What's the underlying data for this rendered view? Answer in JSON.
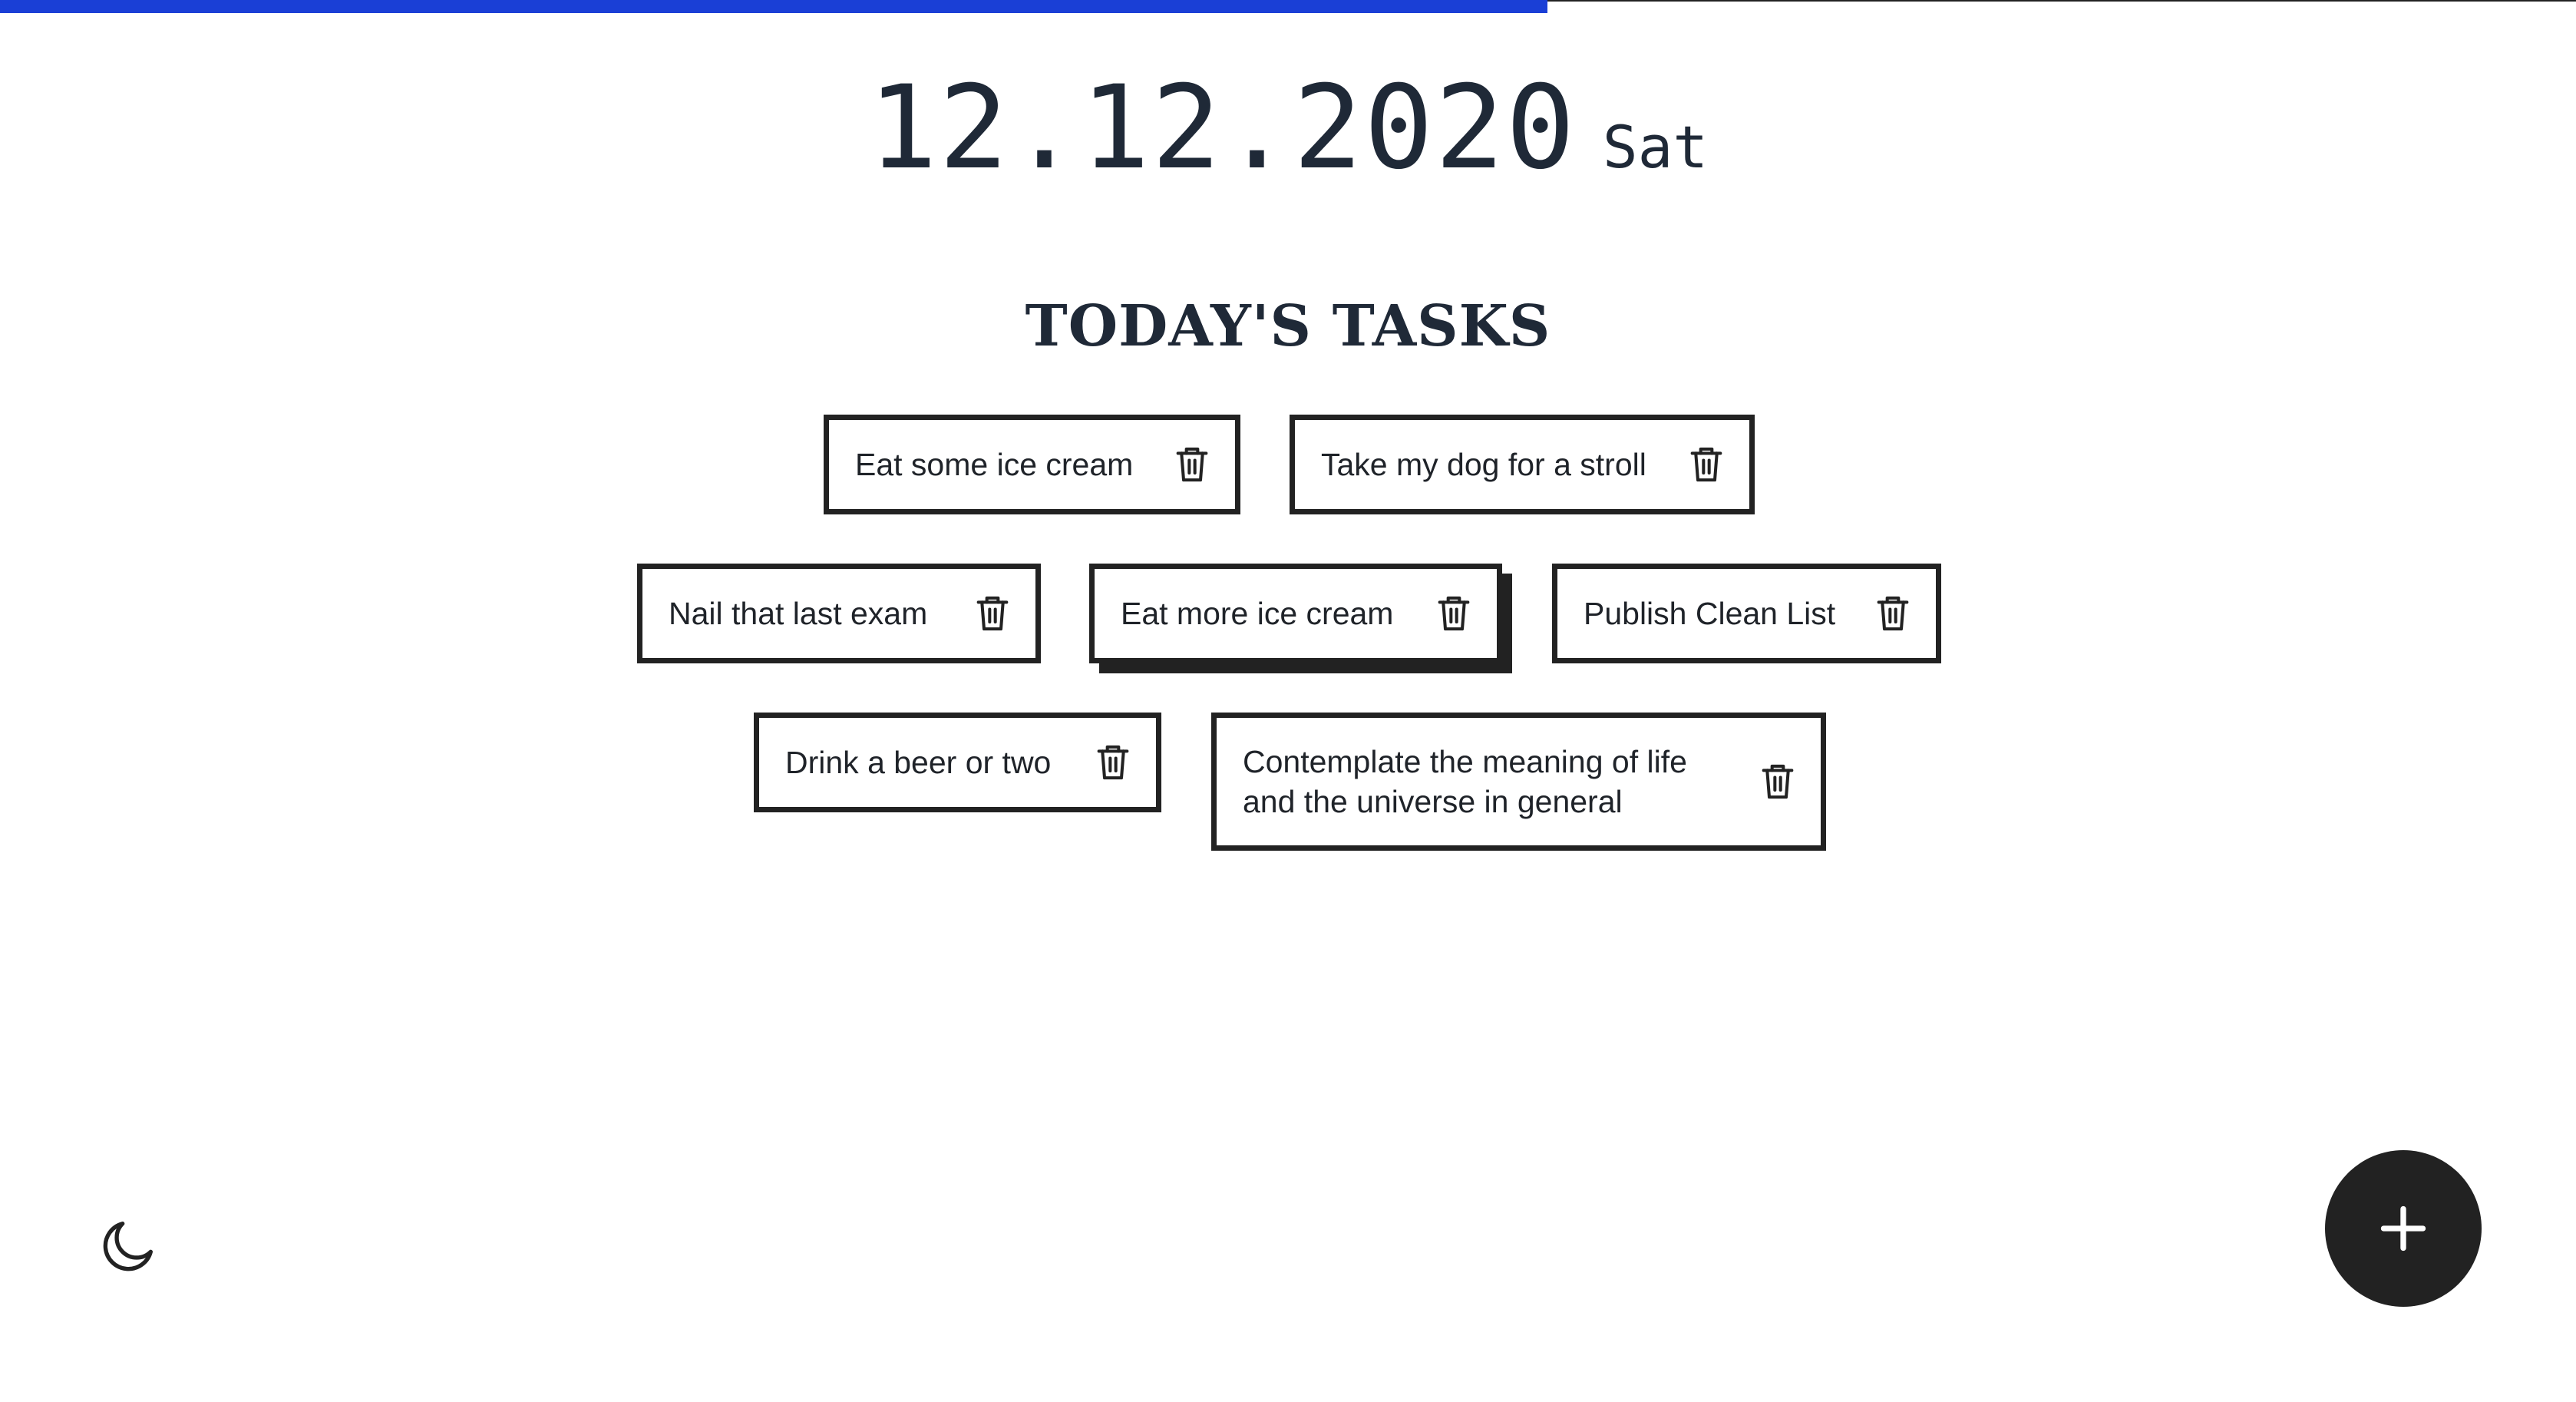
{
  "progress": {
    "fraction": 0.6,
    "color": "#1a3fd6"
  },
  "date": {
    "value": "12.12.2020",
    "weekday": "Sat"
  },
  "heading": "TODAY'S TASKS",
  "tasks": [
    {
      "label": "Eat some ice cream"
    },
    {
      "label": "Take my dog for a stroll"
    },
    {
      "label": "Nail that last exam"
    },
    {
      "label": "Eat more ice cream"
    },
    {
      "label": "Publish Clean List"
    },
    {
      "label": "Drink a beer or two"
    },
    {
      "label": "Contemplate the meaning of life and the universe in general"
    }
  ],
  "icons": {
    "delete": "trash-icon",
    "theme_toggle": "moon-icon",
    "add": "plus-icon"
  },
  "colors": {
    "text": "#1f2937",
    "border": "#222222",
    "fab": "#222222"
  }
}
